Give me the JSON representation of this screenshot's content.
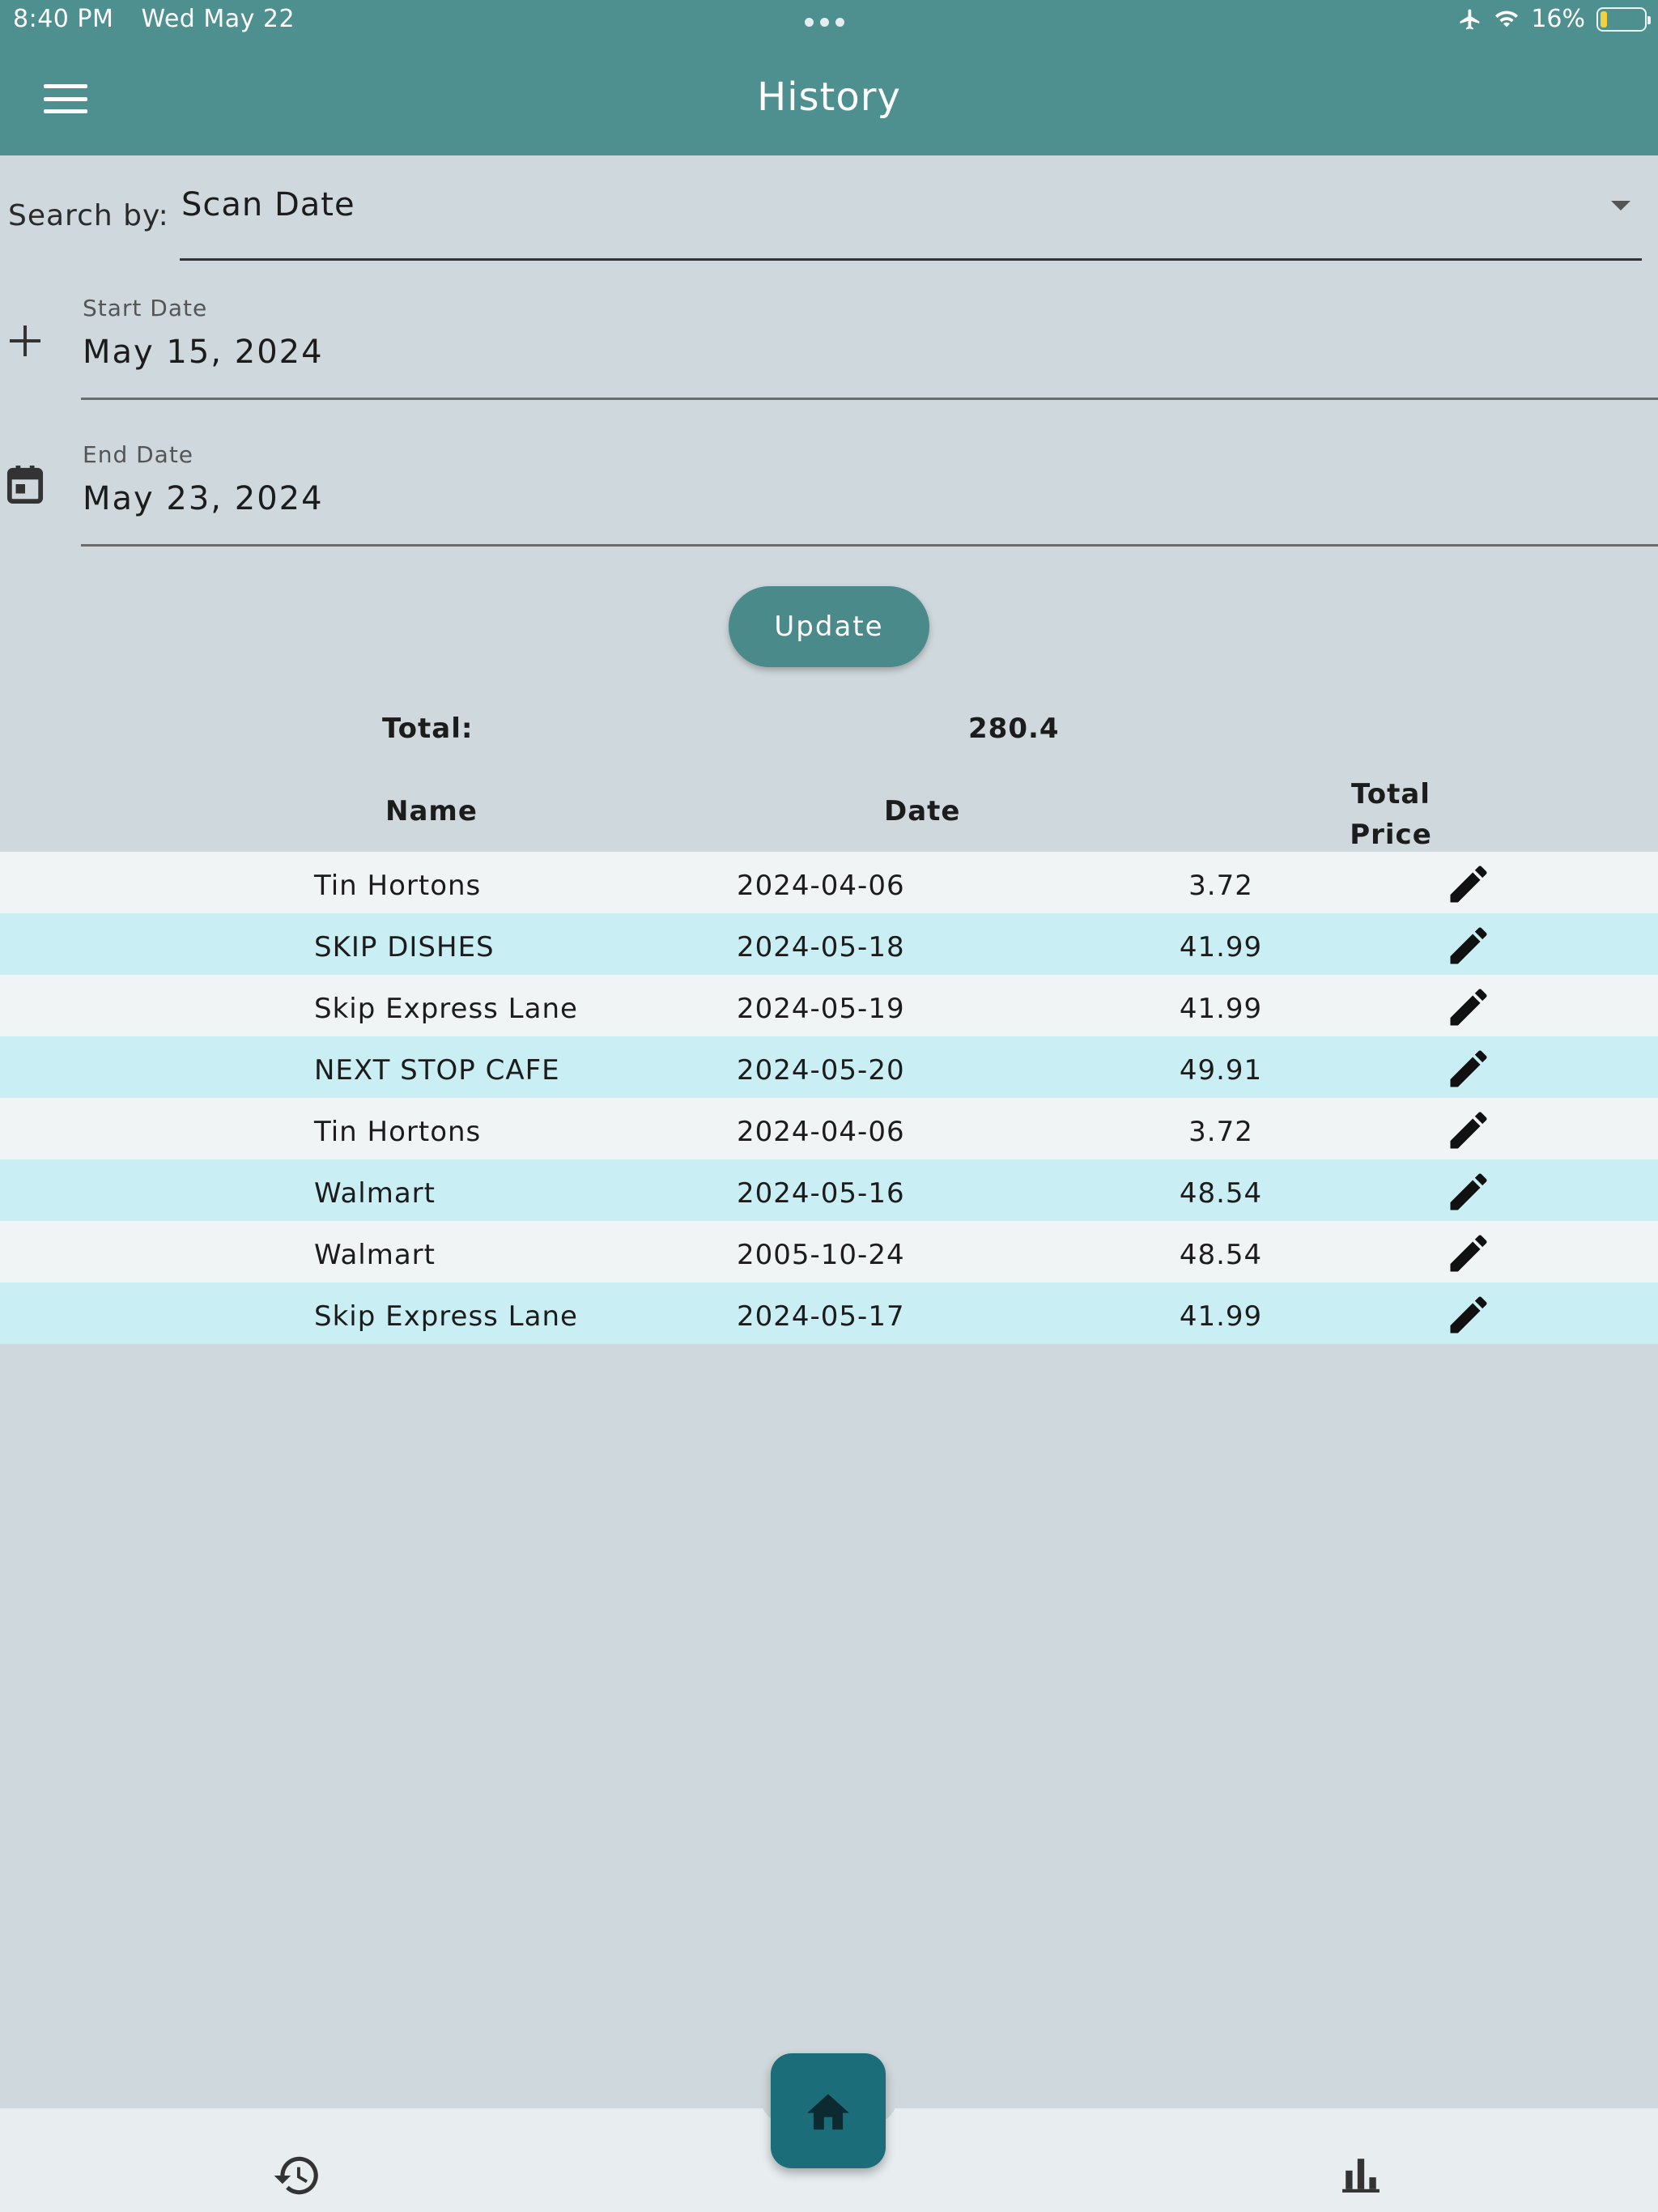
{
  "status_bar": {
    "time": "8:40 PM",
    "date": "Wed May 22",
    "battery": "16%",
    "battery_level": 0.16
  },
  "app_bar": {
    "title": "History",
    "menu_icon": "hamburger-menu-icon"
  },
  "search": {
    "label": "Search by:",
    "selected": "Scan Date"
  },
  "start_date": {
    "label": "Start Date",
    "value": "May 15, 2024",
    "icon": "plus-icon"
  },
  "end_date": {
    "label": "End Date",
    "value": "May 23, 2024",
    "icon": "calendar-icon"
  },
  "update_label": "Update",
  "total": {
    "label": "Total:",
    "value": "280.4"
  },
  "table": {
    "headers": {
      "name": "Name",
      "date": "Date",
      "price_line1": "Total",
      "price_line2": "Price"
    },
    "rows": [
      {
        "name": "Tin Hortons",
        "date": "2024-04-06",
        "price": "3.72"
      },
      {
        "name": "SKIP DISHES",
        "date": "2024-05-18",
        "price": "41.99"
      },
      {
        "name": "Skip Express Lane",
        "date": "2024-05-19",
        "price": "41.99"
      },
      {
        "name": "NEXT STOP CAFE",
        "date": "2024-05-20",
        "price": "49.91"
      },
      {
        "name": "Tin Hortons",
        "date": "2024-04-06",
        "price": "3.72"
      },
      {
        "name": "Walmart",
        "date": "2024-05-16",
        "price": "48.54"
      },
      {
        "name": "Walmart",
        "date": "2005-10-24",
        "price": "48.54"
      },
      {
        "name": "Skip Express Lane",
        "date": "2024-05-17",
        "price": "41.99"
      }
    ],
    "edit_icon": "pencil-icon"
  },
  "bottom_nav": {
    "items": [
      "history-icon",
      "home-icon",
      "bar-chart-icon"
    ]
  },
  "colors": {
    "app_bar": "#4e8f90",
    "background": "#cfd8dc",
    "row_odd": "#f1f4f5",
    "row_even": "#c9eff4",
    "update_button": "#4a8a8a",
    "home_button": "#1b6d7a"
  }
}
